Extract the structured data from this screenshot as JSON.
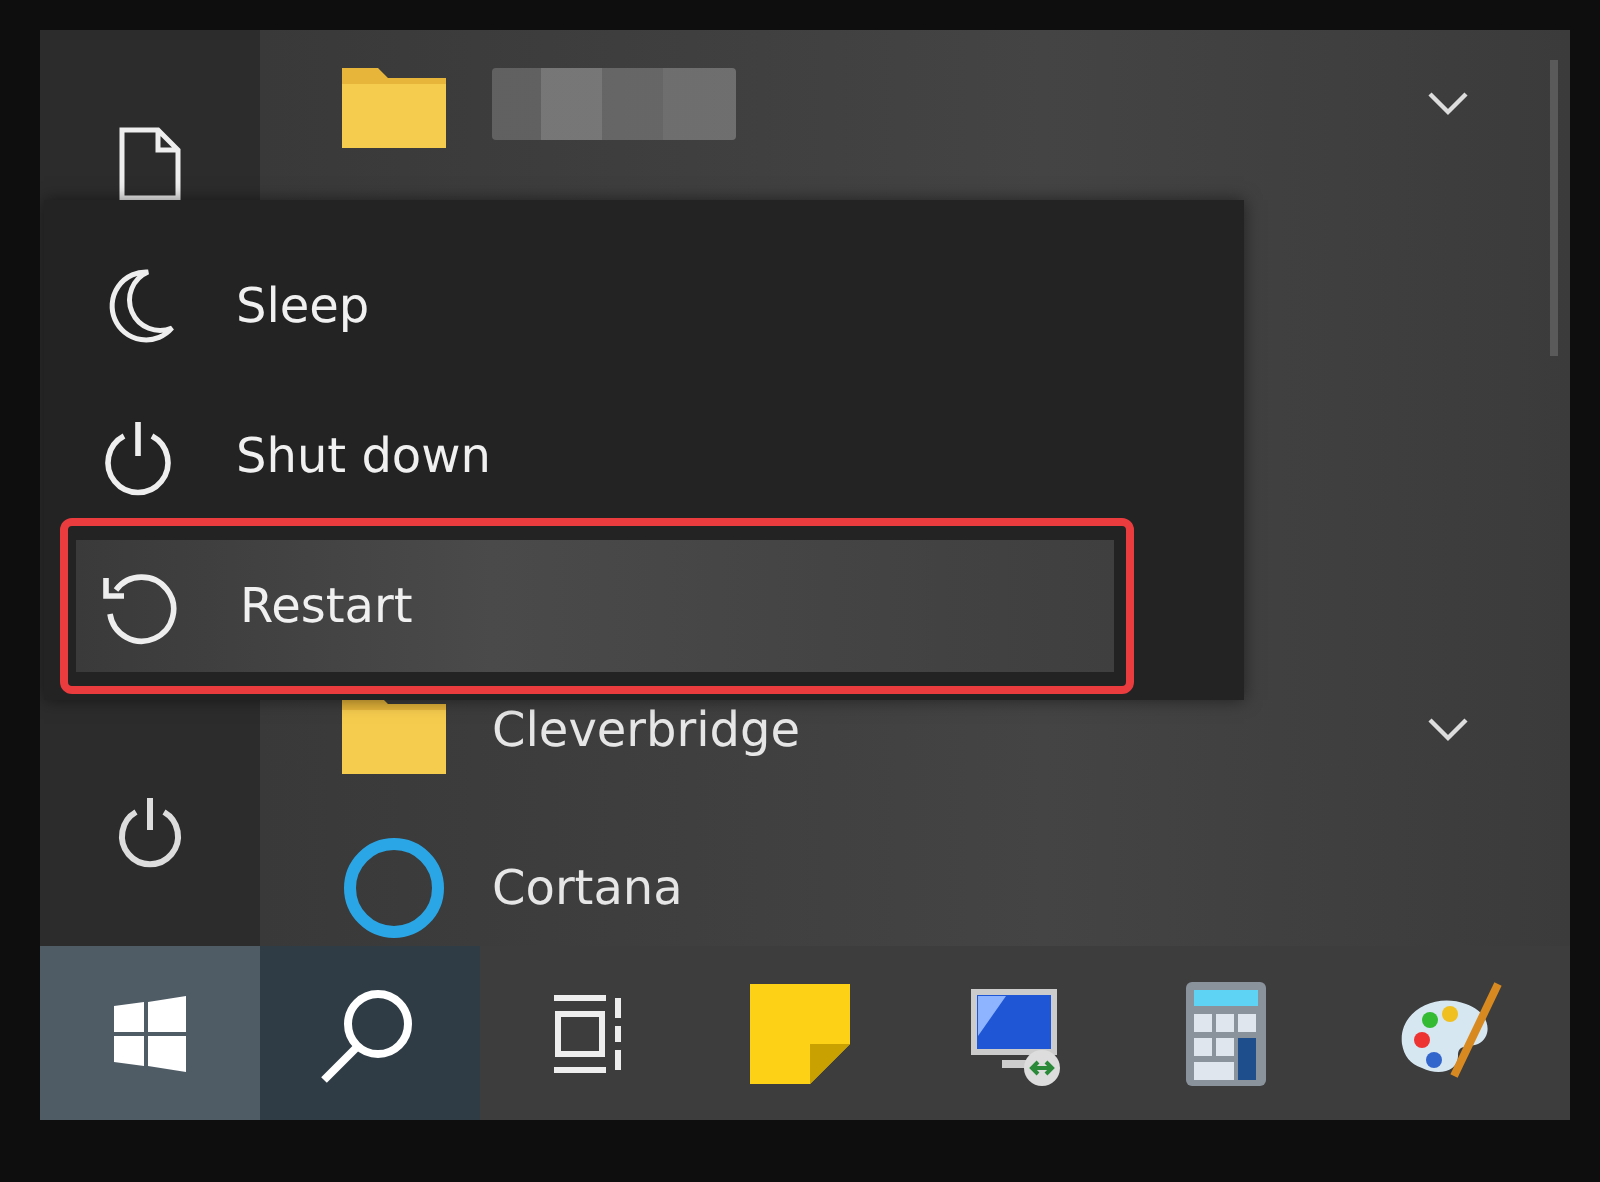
{
  "rail": {
    "items": [
      {
        "kind": "documents"
      },
      {
        "kind": "power"
      }
    ]
  },
  "apps": [
    {
      "kind": "folder",
      "blurred": true,
      "expandable": true
    },
    {
      "kind": "folder",
      "label": "Cleverbridge",
      "expandable": true
    },
    {
      "kind": "cortana",
      "label": "Cortana",
      "expandable": false
    }
  ],
  "power_menu": {
    "items": [
      {
        "kind": "sleep",
        "label": "Sleep",
        "selected": false,
        "annotated": false
      },
      {
        "kind": "shutdown",
        "label": "Shut down",
        "selected": false,
        "annotated": false
      },
      {
        "kind": "restart",
        "label": "Restart",
        "selected": true,
        "annotated": true
      }
    ]
  },
  "taskbar": {
    "buttons": [
      {
        "kind": "start",
        "selected": true
      },
      {
        "kind": "search",
        "selected": true
      },
      {
        "kind": "taskview",
        "selected": false
      },
      {
        "kind": "sticky",
        "selected": false
      },
      {
        "kind": "remote",
        "selected": false
      },
      {
        "kind": "calculator",
        "selected": false
      },
      {
        "kind": "paint",
        "selected": false
      }
    ]
  }
}
